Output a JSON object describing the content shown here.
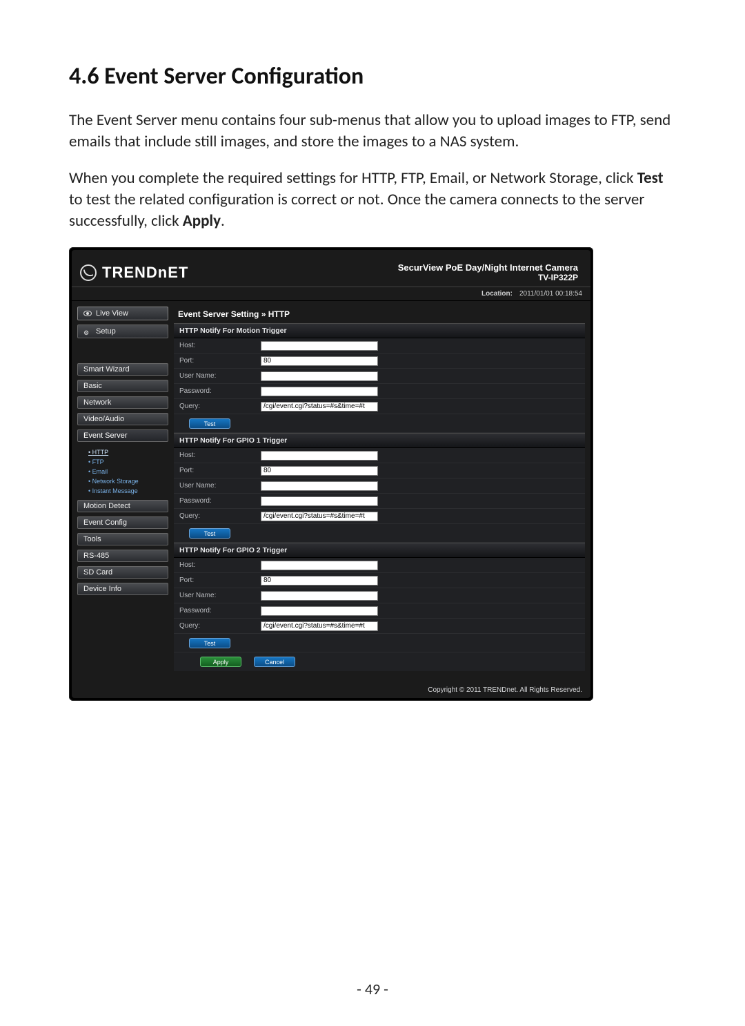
{
  "doc": {
    "heading": "4.6  Event Server Configuration",
    "para1": "The Event Server menu contains four sub-menus that allow you to upload images to FTP, send emails that include still images, and store the images to a NAS system.",
    "para2a": "When you complete the required settings for HTTP, FTP, Email, or Network Storage, click ",
    "para2b": "Test",
    "para2c": " to test the related configuration is correct or not. Once the camera connects to the server successfully, click ",
    "para2d": "Apply",
    "para2e": ".",
    "page_number": "- 49 -"
  },
  "app": {
    "brand": "TRENDNET",
    "product_line1": "SecurView PoE Day/Night Internet Camera",
    "product_line2": "TV-IP322P",
    "location_label": "Location:",
    "timestamp": "2011/01/01 00:18:54",
    "copyright": "Copyright © 2011 TRENDnet. All Rights Reserved."
  },
  "sidebar": {
    "live_view": "Live View",
    "setup": "Setup",
    "items": [
      "Smart Wizard",
      "Basic",
      "Network",
      "Video/Audio",
      "Event Server",
      "Motion Detect",
      "Event Config",
      "Tools",
      "RS-485",
      "SD Card",
      "Device Info"
    ],
    "sub_items": [
      "HTTP",
      "FTP",
      "Email",
      "Network Storage",
      "Instant Message"
    ]
  },
  "panel": {
    "title": "Event Server Setting » HTTP",
    "sections": [
      {
        "header": "HTTP Notify For Motion Trigger"
      },
      {
        "header": "HTTP Notify For GPIO 1 Trigger"
      },
      {
        "header": "HTTP Notify For GPIO 2 Trigger"
      }
    ],
    "labels": {
      "host": "Host:",
      "port": "Port:",
      "user": "User Name:",
      "pass": "Password:",
      "query": "Query:"
    },
    "defaults": {
      "host": "",
      "port": "80",
      "user": "",
      "pass": "",
      "query": "/cgi/event.cgi?status=#s&time=#t"
    },
    "buttons": {
      "test": "Test",
      "apply": "Apply",
      "cancel": "Cancel"
    }
  }
}
